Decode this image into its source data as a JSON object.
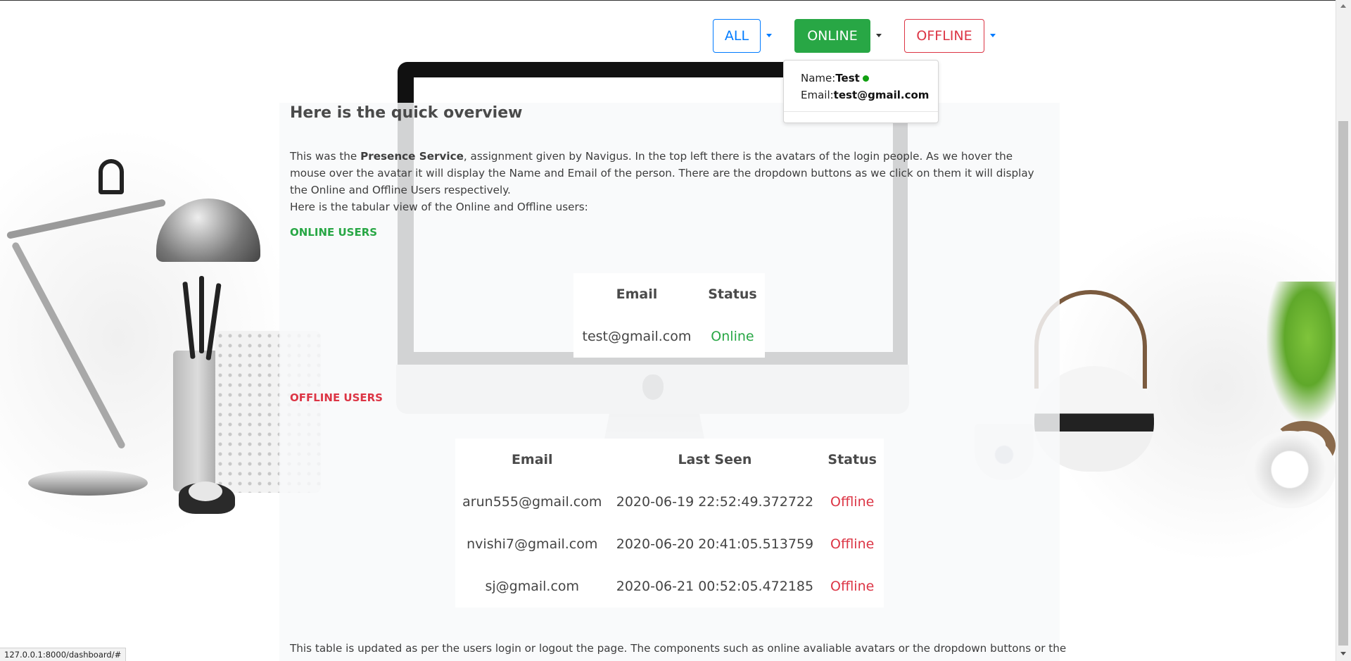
{
  "toolbar": {
    "all_label": "ALL",
    "online_label": "ONLINE",
    "offline_label": "OFFLINE"
  },
  "online_dropdown": {
    "name_label": "Name:",
    "name_value": "Test",
    "email_label": "Email:",
    "email_value": "test@gmail.com"
  },
  "overview": {
    "title": "Here is the quick overview",
    "intro_before": "This was the ",
    "intro_bold": "Presence Service",
    "intro_after": ", assignment given by Navigus. In the top left there is the avatars of the login people. As we hover the mouse over the avatar it will display the Name and Email of the person. There are the dropdown buttons as we click on them it will display the Online and Offline Users respectively.",
    "tabular_line": "Here is the tabular view of the Online and Offline users:"
  },
  "online_section": {
    "heading": "ONLINE USERS",
    "headers": [
      "Email",
      "Status"
    ],
    "rows": [
      {
        "email": "test@gmail.com",
        "status": "Online"
      }
    ]
  },
  "offline_section": {
    "heading": "OFFLINE USERS",
    "headers": [
      "Email",
      "Last Seen",
      "Status"
    ],
    "rows": [
      {
        "email": "arun555@gmail.com",
        "last_seen": "2020-06-19 22:52:49.372722",
        "status": "Offline"
      },
      {
        "email": "nvishi7@gmail.com",
        "last_seen": "2020-06-20 20:41:05.513759",
        "status": "Offline"
      },
      {
        "email": "sj@gmail.com",
        "last_seen": "2020-06-21 00:52:05.472185",
        "status": "Offline"
      }
    ]
  },
  "footer": {
    "text": "This table is updated as per the users login or logout the page. The components such as online avaliable avatars or the dropdown buttons or the"
  },
  "status_bar": {
    "url": "127.0.0.1:8000/dashboard/#"
  },
  "colors": {
    "online": "#28a745",
    "offline": "#dc3545",
    "primary": "#007bff"
  }
}
